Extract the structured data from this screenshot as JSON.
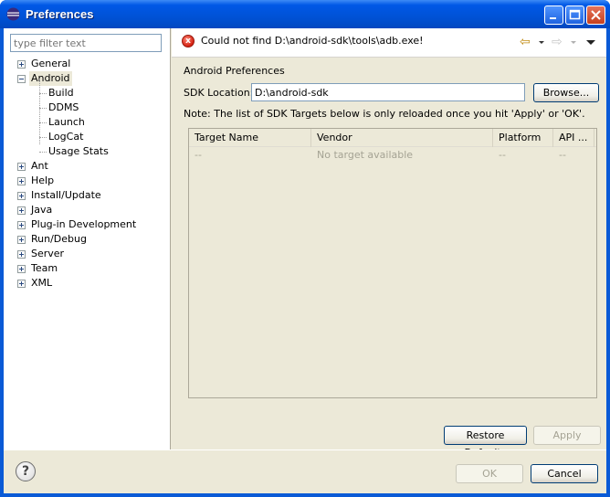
{
  "window": {
    "title": "Preferences"
  },
  "filter": {
    "placeholder": "type filter text"
  },
  "tree": {
    "items": [
      {
        "label": "General",
        "expander": "plus",
        "selected": false
      },
      {
        "label": "Android",
        "expander": "minus",
        "selected": true
      },
      {
        "label": "Build"
      },
      {
        "label": "DDMS"
      },
      {
        "label": "Launch"
      },
      {
        "label": "LogCat"
      },
      {
        "label": "Usage Stats"
      },
      {
        "label": "Ant",
        "expander": "plus"
      },
      {
        "label": "Help",
        "expander": "plus"
      },
      {
        "label": "Install/Update",
        "expander": "plus"
      },
      {
        "label": "Java",
        "expander": "plus"
      },
      {
        "label": "Plug-in Development",
        "expander": "plus"
      },
      {
        "label": "Run/Debug",
        "expander": "plus"
      },
      {
        "label": "Server",
        "expander": "plus"
      },
      {
        "label": "Team",
        "expander": "plus"
      },
      {
        "label": "XML",
        "expander": "plus"
      }
    ]
  },
  "message": {
    "text": "Could not find D:\\android-sdk\\tools\\adb.exe!"
  },
  "page": {
    "title": "Android Preferences",
    "sdk_label": "SDK Location:",
    "sdk_value": "D:\\android-sdk",
    "browse_label": "Browse...",
    "note": "Note: The list of SDK Targets below is only reloaded once you hit 'Apply' or 'OK'."
  },
  "targets_table": {
    "headers": [
      "Target Name",
      "Vendor",
      "Platform",
      "API ..."
    ],
    "row": [
      "--",
      "No target available",
      "--",
      "--"
    ]
  },
  "buttons": {
    "restore_defaults": "Restore Defaults",
    "apply": "Apply",
    "ok": "OK",
    "cancel": "Cancel",
    "help": "?"
  },
  "icons": {
    "error": "error-icon",
    "back": "back-arrow-icon",
    "forward": "forward-arrow-icon",
    "view_menu": "view-menu-icon"
  },
  "colors": {
    "titlebar": "#0058e6",
    "dialog_background": "#ece9d8",
    "error": "#d42010"
  }
}
